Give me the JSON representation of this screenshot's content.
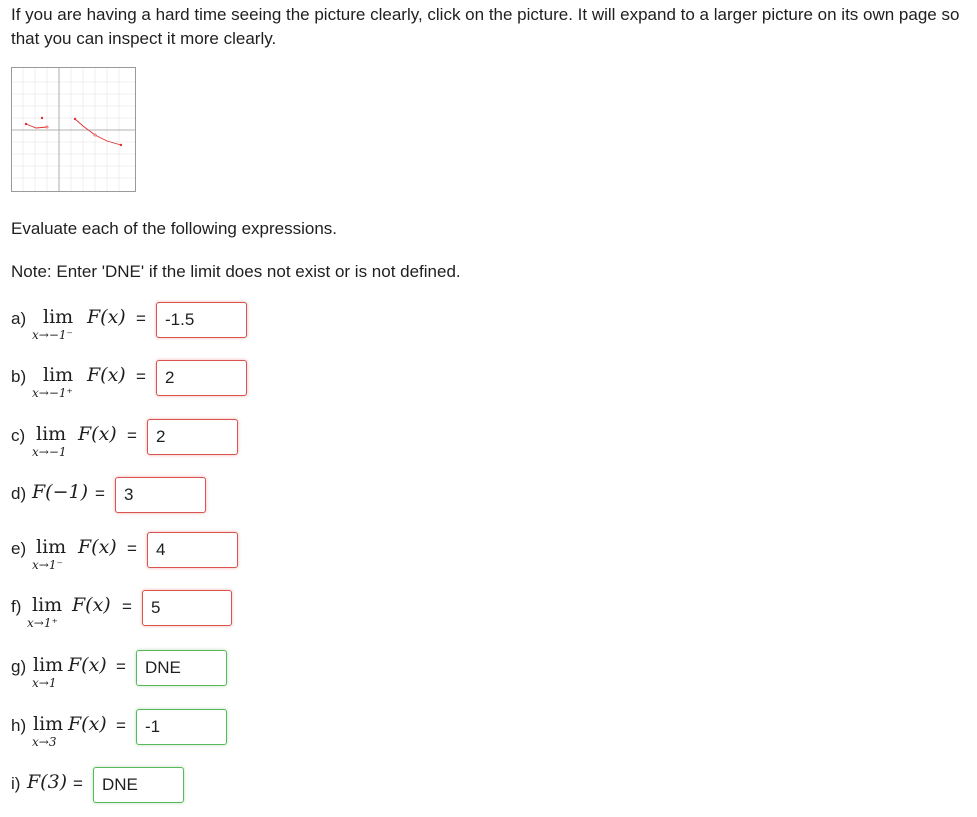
{
  "intro_text": "If you are having a hard time seeing the picture clearly, click on the picture. It will expand to a larger picture on its own page so that you can inspect it more clearly.",
  "instruction": "Evaluate each of the following expressions.",
  "note": "Note: Enter 'DNE' if the limit does not exist or is not defined.",
  "colors": {
    "incorrect": "#d9534f",
    "correct": "#5cb85c",
    "graph_line": "#e03030"
  },
  "questions": [
    {
      "letter": "a)",
      "lim": "lim",
      "sub": "x→−1⁻",
      "fx": "F(x)",
      "eq": "=",
      "answer": "-1.5",
      "status": "incorrect"
    },
    {
      "letter": "b)",
      "lim": "lim",
      "sub": "x→−1⁺",
      "fx": "F(x)",
      "eq": "=",
      "answer": "2",
      "status": "incorrect"
    },
    {
      "letter": "c)",
      "lim": "lim",
      "sub": "x→−1",
      "fx": "F(x)",
      "eq": "=",
      "answer": "2",
      "status": "incorrect"
    },
    {
      "letter": "d)",
      "fx": "F(−1)",
      "eq": "=",
      "answer": "3",
      "status": "incorrect"
    },
    {
      "letter": "e)",
      "lim": "lim",
      "sub": "x→1⁻",
      "fx": "F(x)",
      "eq": "=",
      "answer": "4",
      "status": "incorrect"
    },
    {
      "letter": "f)",
      "lim": "lim",
      "sub": "x→1⁺",
      "fx": "F(x)",
      "eq": "=",
      "answer": "5",
      "status": "incorrect"
    },
    {
      "letter": "g)",
      "lim": "lim",
      "sub": "x→1",
      "fx": "F(x)",
      "eq": "=",
      "answer": "DNE",
      "status": "correct"
    },
    {
      "letter": "h)",
      "lim": "lim",
      "sub": "x→3",
      "fx": "F(x)",
      "eq": "=",
      "answer": "-1",
      "status": "correct"
    },
    {
      "letter": "i)",
      "fx": "F(3)",
      "eq": "=",
      "answer": "DNE",
      "status": "correct"
    }
  ]
}
